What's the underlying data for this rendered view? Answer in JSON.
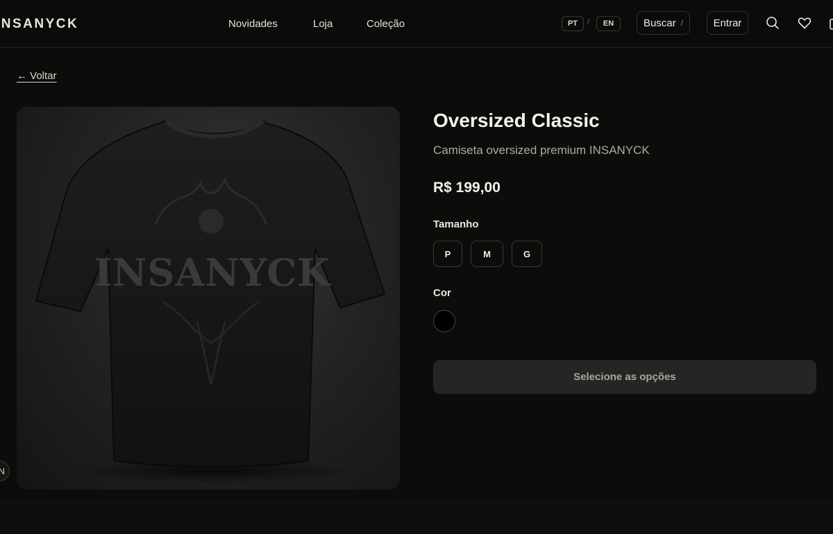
{
  "brand": {
    "logo_text": "INSANYCK"
  },
  "nav": {
    "items": [
      "Novidades",
      "Loja",
      "Coleção"
    ]
  },
  "lang": {
    "pt": "PT",
    "separator": "/",
    "en": "EN"
  },
  "header": {
    "search_label": "Buscar",
    "search_shortcut": "/",
    "login_label": "Entrar",
    "icons": [
      "search-icon",
      "heart-icon",
      "bag-icon"
    ]
  },
  "back_link": "← Voltar",
  "product": {
    "name": "Oversized Classic",
    "description": "Camiseta oversized premium INSANYCK",
    "price": "R$ 199,00",
    "image_alt": "Camiseta preta oversized com estampa INSANYCK",
    "print_text": "INSANYCK",
    "size_label": "Tamanho",
    "sizes": [
      "P",
      "M",
      "G"
    ],
    "color_label": "Cor",
    "colors": [
      {
        "name": "Preto",
        "hex": "#000000"
      }
    ],
    "cta_label": "Selecione as opções"
  },
  "corner_badge": "N",
  "theme": {
    "background": "#0e0d0b",
    "cta_bg": "#252523",
    "text": "#f2f0ea"
  }
}
